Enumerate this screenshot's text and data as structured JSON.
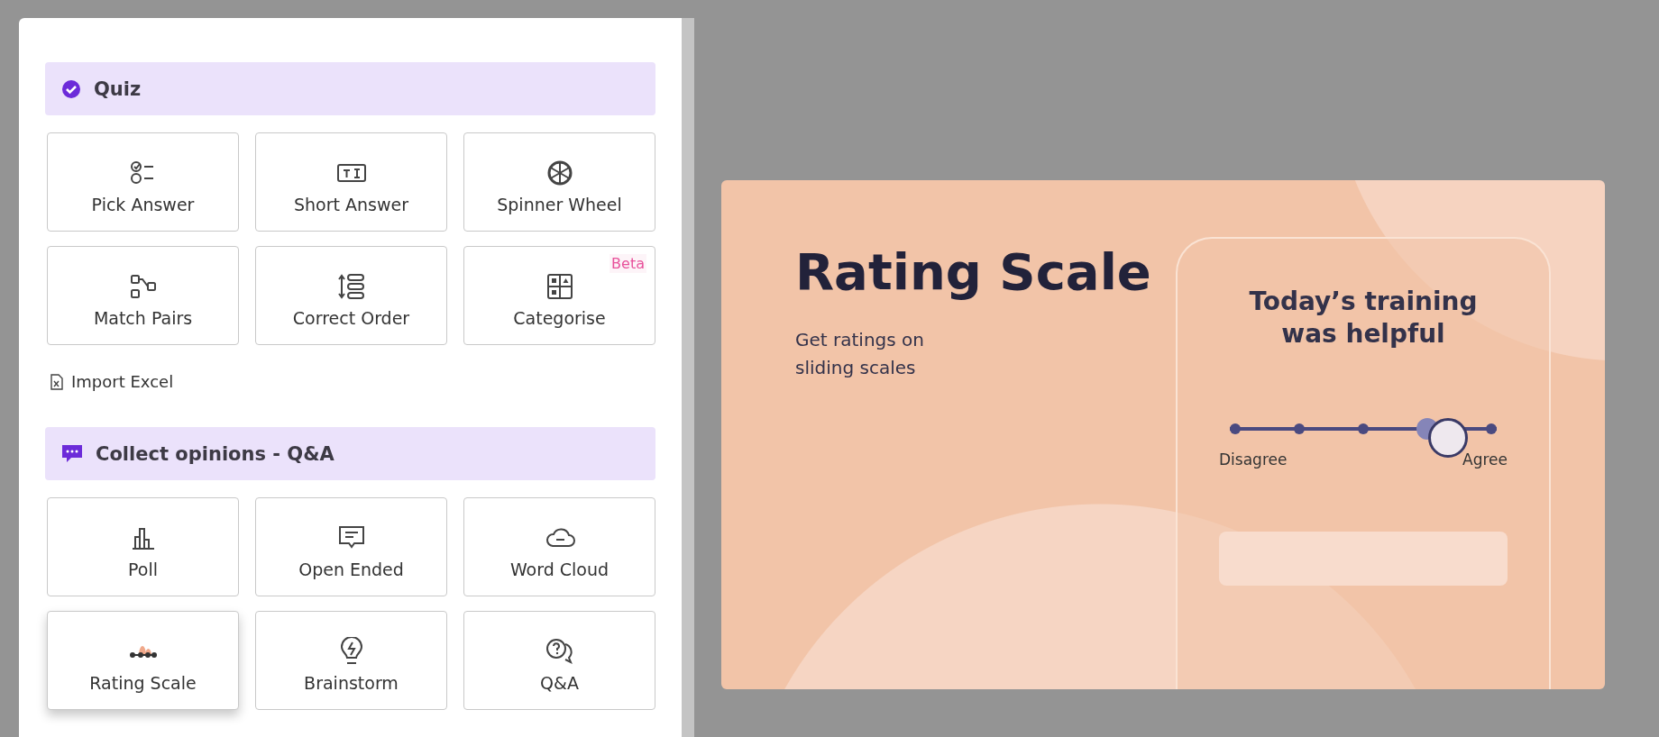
{
  "sections": [
    {
      "kind": "quiz",
      "title": "Quiz",
      "tiles": [
        {
          "kind": "pick",
          "label": "Pick Answer",
          "selected": false
        },
        {
          "kind": "short",
          "label": "Short Answer",
          "selected": false
        },
        {
          "kind": "spinner",
          "label": "Spinner Wheel",
          "selected": false
        },
        {
          "kind": "match",
          "label": "Match Pairs",
          "selected": false
        },
        {
          "kind": "order",
          "label": "Correct Order",
          "selected": false
        },
        {
          "kind": "categorise",
          "label": "Categorise",
          "selected": false,
          "badge": "Beta"
        }
      ],
      "link": "Import Excel"
    },
    {
      "kind": "opinions",
      "title": "Collect opinions - Q&A",
      "tiles": [
        {
          "kind": "poll",
          "label": "Poll",
          "selected": false
        },
        {
          "kind": "open",
          "label": "Open Ended",
          "selected": false
        },
        {
          "kind": "cloud",
          "label": "Word Cloud",
          "selected": false
        },
        {
          "kind": "rating",
          "label": "Rating Scale",
          "selected": true
        },
        {
          "kind": "brainstorm",
          "label": "Brainstorm",
          "selected": false
        },
        {
          "kind": "qa",
          "label": "Q&A",
          "selected": false
        }
      ]
    }
  ],
  "preview": {
    "title": "Rating Scale",
    "subtitle": "Get ratings on sliding scales",
    "question": "Today’s training was helpful",
    "slider": {
      "level": 0.83,
      "min_label": "Disagree",
      "max_label": "Agree"
    }
  }
}
